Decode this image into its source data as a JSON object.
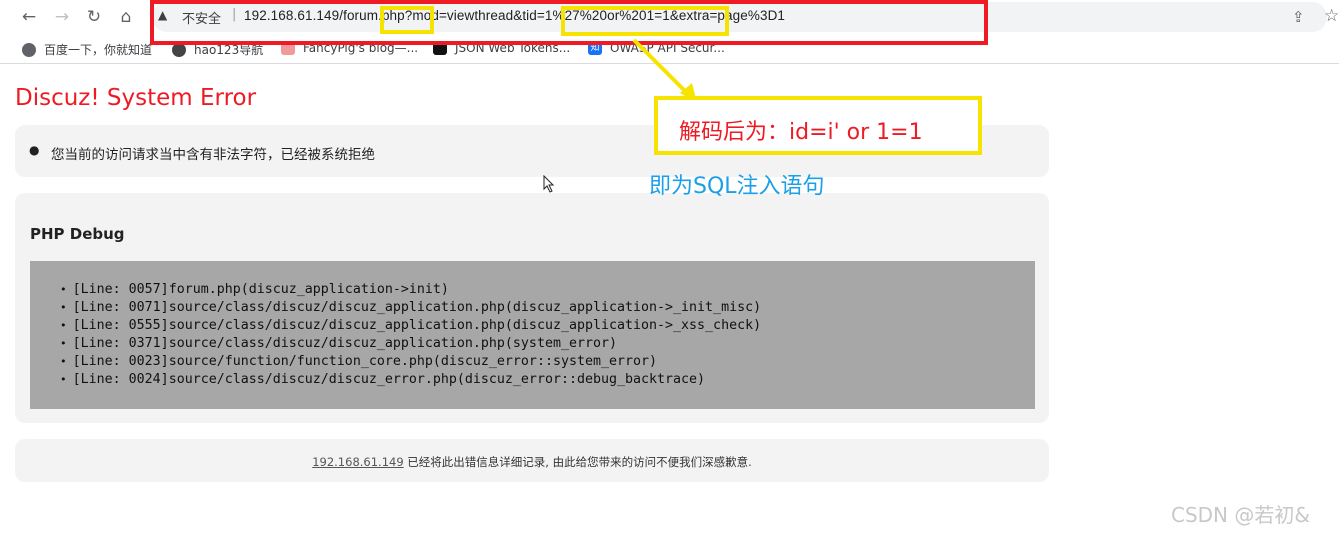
{
  "browser": {
    "security_label": "不安全",
    "separator": "|",
    "url": "192.168.61.149/forum.php?mod=viewthread&tid=1%27%20or%201=1&extra=page%3D1",
    "bookmarks": [
      {
        "label": "百度一下，你就知道",
        "icon": "globe-icon"
      },
      {
        "label": "hao123导航",
        "icon": "hao123-icon"
      },
      {
        "label": "FancyPig's blog—...",
        "icon": "pig-icon"
      },
      {
        "label": "JSON Web Tokens...",
        "icon": "jwt-icon"
      },
      {
        "label": "OWASP API Secur...",
        "icon": "zhihu-icon"
      }
    ]
  },
  "annotations": {
    "decoded_label": "解码后为：id=i' or 1=1",
    "sql_label": "即为SQL注入语句",
    "colors": {
      "red": "#ee1b24",
      "yellow": "#f6e400",
      "blue": "#1aa0e8"
    }
  },
  "page": {
    "error_title": "Discuz! System Error",
    "error_message": "您当前的访问请求当中含有非法字符，已经被系统拒绝",
    "debug_title": "PHP Debug",
    "trace": [
      "[Line: 0057]forum.php(discuz_application->init)",
      "[Line: 0071]source/class/discuz/discuz_application.php(discuz_application->_init_misc)",
      "[Line: 0555]source/class/discuz/discuz_application.php(discuz_application->_xss_check)",
      "[Line: 0371]source/class/discuz/discuz_application.php(system_error)",
      "[Line: 0023]source/function/function_core.php(discuz_error::system_error)",
      "[Line: 0024]source/class/discuz/discuz_error.php(discuz_error::debug_backtrace)"
    ],
    "footer_ip": "192.168.61.149",
    "footer_text": " 已经将此出错信息详细记录, 由此给您带来的访问不便我们深感歉意."
  },
  "watermark": "CSDN @若初&"
}
